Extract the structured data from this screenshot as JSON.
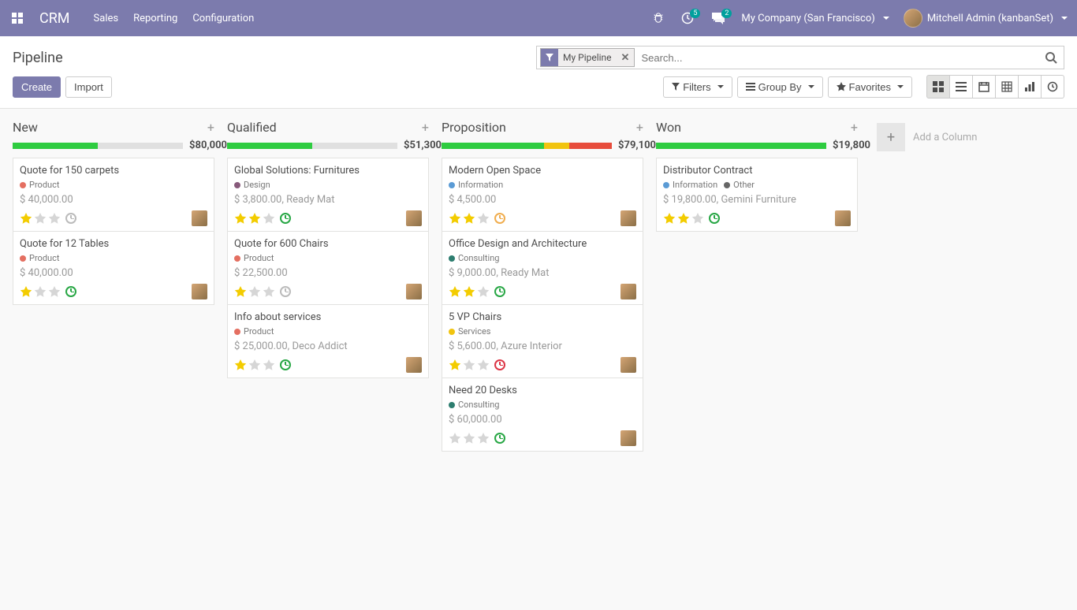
{
  "brand": "CRM",
  "nav": {
    "sales": "Sales",
    "reporting": "Reporting",
    "config": "Configuration"
  },
  "systray": {
    "debug_badge": "5",
    "msg_badge": "2"
  },
  "company": "My Company (San Francisco)",
  "user": "Mitchell Admin (kanbanSet)",
  "breadcrumb": "Pipeline",
  "search": {
    "facet_label": "My Pipeline",
    "placeholder": "Search..."
  },
  "buttons": {
    "create": "Create",
    "import": "Import",
    "filters": "Filters",
    "groupby": "Group By",
    "favorites": "Favorites"
  },
  "add_column": "Add a Column",
  "columns": [
    {
      "title": "New",
      "amount": "$80,000",
      "bars": [
        [
          "#2ecc40",
          50
        ],
        [
          "#e0e0e0",
          50
        ]
      ],
      "cards": [
        {
          "title": "Quote for 150 carpets",
          "tags": [
            [
              "#e46f61",
              "Product"
            ]
          ],
          "sub": "$ 40,000.00",
          "stars": 1,
          "clock": "gray"
        },
        {
          "title": "Quote for 12 Tables",
          "tags": [
            [
              "#e46f61",
              "Product"
            ]
          ],
          "sub": "$ 40,000.00",
          "stars": 1,
          "clock": "green"
        }
      ]
    },
    {
      "title": "Qualified",
      "amount": "$51,300",
      "bars": [
        [
          "#2ecc40",
          50
        ],
        [
          "#e0e0e0",
          50
        ]
      ],
      "cards": [
        {
          "title": "Global Solutions: Furnitures",
          "tags": [
            [
              "#875a7b",
              "Design"
            ]
          ],
          "sub": "$ 3,800.00, Ready Mat",
          "stars": 2,
          "clock": "green"
        },
        {
          "title": "Quote for 600 Chairs",
          "tags": [
            [
              "#e46f61",
              "Product"
            ]
          ],
          "sub": "$ 22,500.00",
          "stars": 1,
          "clock": "gray"
        },
        {
          "title": "Info about services",
          "tags": [
            [
              "#e46f61",
              "Product"
            ]
          ],
          "sub": "$ 25,000.00, Deco Addict",
          "stars": 1,
          "clock": "green"
        }
      ]
    },
    {
      "title": "Proposition",
      "amount": "$79,100",
      "bars": [
        [
          "#2ecc40",
          60
        ],
        [
          "#f1c40f",
          15
        ],
        [
          "#e74c3c",
          25
        ]
      ],
      "cards": [
        {
          "title": "Modern Open Space",
          "tags": [
            [
              "#5b9bd5",
              "Information"
            ]
          ],
          "sub": "$ 4,500.00",
          "stars": 2,
          "clock": "orange"
        },
        {
          "title": "Office Design and Architecture",
          "tags": [
            [
              "#2d7d6f",
              "Consulting"
            ]
          ],
          "sub": "$ 9,000.00, Ready Mat",
          "stars": 2,
          "clock": "green"
        },
        {
          "title": "5 VP Chairs",
          "tags": [
            [
              "#f1c40f",
              "Services"
            ]
          ],
          "sub": "$ 5,600.00, Azure Interior",
          "stars": 1,
          "clock": "red"
        },
        {
          "title": "Need 20 Desks",
          "tags": [
            [
              "#2d7d6f",
              "Consulting"
            ]
          ],
          "sub": "$ 60,000.00",
          "stars": 0,
          "clock": "green"
        }
      ]
    },
    {
      "title": "Won",
      "amount": "$19,800",
      "bars": [
        [
          "#2ecc40",
          100
        ]
      ],
      "cards": [
        {
          "title": "Distributor Contract",
          "tags": [
            [
              "#5b9bd5",
              "Information"
            ],
            [
              "#666",
              "Other"
            ]
          ],
          "sub": "$ 19,800.00, Gemini Furniture",
          "stars": 2,
          "clock": "green"
        }
      ]
    }
  ]
}
